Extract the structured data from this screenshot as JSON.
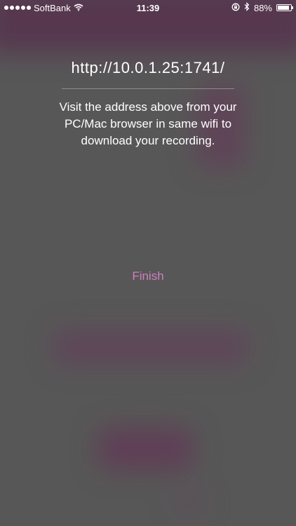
{
  "status_bar": {
    "carrier": "SoftBank",
    "time": "11:39",
    "battery_percent_label": "88%",
    "battery_level": 0.88,
    "icons": [
      "signal-dots-icon",
      "wifi-icon",
      "rotation-lock-icon",
      "bluetooth-icon",
      "battery-icon"
    ]
  },
  "main": {
    "address": "http://10.0.1.25:1741/",
    "instructions": "Visit the address above from your PC/Mac browser in same wifi to download your recording.",
    "finish_label": "Finish"
  },
  "colors": {
    "accent": "#d07fc0",
    "header_bg": "#5a2a4e",
    "overlay": "#5b5b5b"
  }
}
